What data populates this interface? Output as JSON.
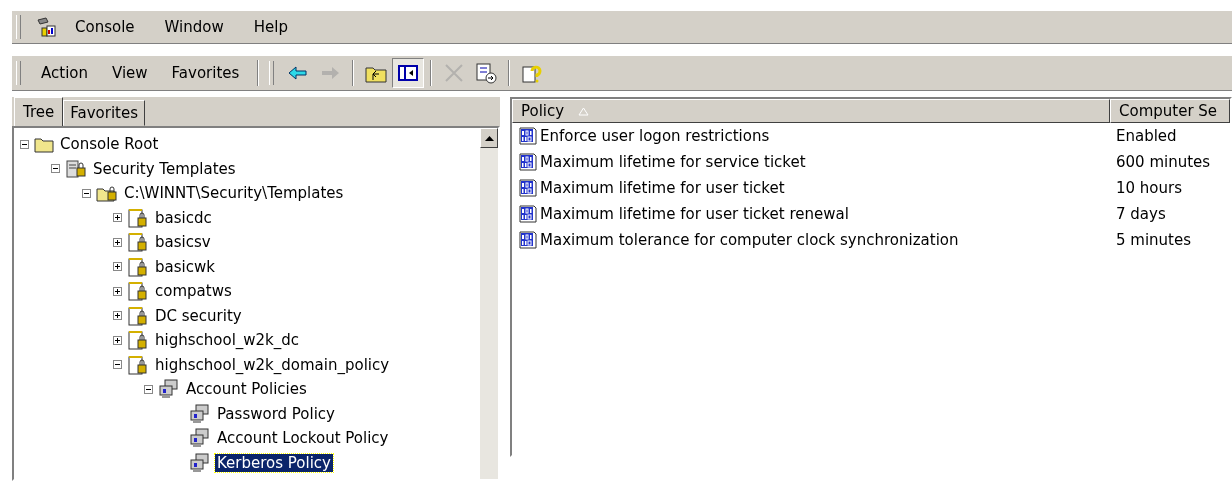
{
  "menu_bar": [
    "Console",
    "Window",
    "Help"
  ],
  "action_menu": [
    "Action",
    "View",
    "Favorites"
  ],
  "toolbar": [
    {
      "kind": "back",
      "disabled": false
    },
    {
      "kind": "forward",
      "disabled": true
    },
    {
      "kind": "sep"
    },
    {
      "kind": "up",
      "disabled": false
    },
    {
      "kind": "tree",
      "disabled": false,
      "pressed": true
    },
    {
      "kind": "sep"
    },
    {
      "kind": "delete",
      "disabled": true
    },
    {
      "kind": "export",
      "disabled": false
    },
    {
      "kind": "sep"
    },
    {
      "kind": "help",
      "disabled": false
    }
  ],
  "tabs": [
    {
      "label": "Tree",
      "selected": true
    },
    {
      "label": "Favorites",
      "selected": false
    }
  ],
  "tree": [
    {
      "label": "Console Root",
      "kind": "folder",
      "expanded": true,
      "selected": false,
      "children": [
        {
          "label": "Security Templates",
          "kind": "server",
          "expanded": true,
          "selected": false,
          "children": [
            {
              "label": "C:\\WINNT\\Security\\Templates",
              "kind": "folder-lock",
              "expanded": true,
              "selected": false,
              "children": [
                {
                  "label": "basicdc",
                  "kind": "template",
                  "expanded": false,
                  "selected": false
                },
                {
                  "label": "basicsv",
                  "kind": "template",
                  "expanded": false,
                  "selected": false
                },
                {
                  "label": "basicwk",
                  "kind": "template",
                  "expanded": false,
                  "selected": false
                },
                {
                  "label": "compatws",
                  "kind": "template",
                  "expanded": false,
                  "selected": false
                },
                {
                  "label": "DC security",
                  "kind": "template",
                  "expanded": false,
                  "selected": false
                },
                {
                  "label": "highschool_w2k_dc",
                  "kind": "template",
                  "expanded": false,
                  "selected": false
                },
                {
                  "label": "highschool_w2k_domain_policy",
                  "kind": "template",
                  "expanded": true,
                  "selected": false,
                  "children": [
                    {
                      "label": "Account Policies",
                      "kind": "policy",
                      "expanded": true,
                      "selected": false,
                      "children": [
                        {
                          "label": "Password Policy",
                          "kind": "policy",
                          "selected": false
                        },
                        {
                          "label": "Account Lockout Policy",
                          "kind": "policy",
                          "selected": false
                        },
                        {
                          "label": "Kerberos Policy",
                          "kind": "policy",
                          "selected": true
                        }
                      ]
                    }
                  ]
                }
              ]
            }
          ]
        }
      ]
    }
  ],
  "table": {
    "columns": [
      "Policy",
      "Computer Se"
    ],
    "rows": [
      {
        "policy": "Enforce user logon restrictions",
        "value": "Enabled"
      },
      {
        "policy": "Maximum lifetime for service ticket",
        "value": "600 minutes"
      },
      {
        "policy": "Maximum lifetime for user ticket",
        "value": "10 hours"
      },
      {
        "policy": "Maximum lifetime for user ticket renewal",
        "value": "7 days"
      },
      {
        "policy": "Maximum tolerance for computer clock synchronization",
        "value": "5 minutes"
      }
    ]
  }
}
